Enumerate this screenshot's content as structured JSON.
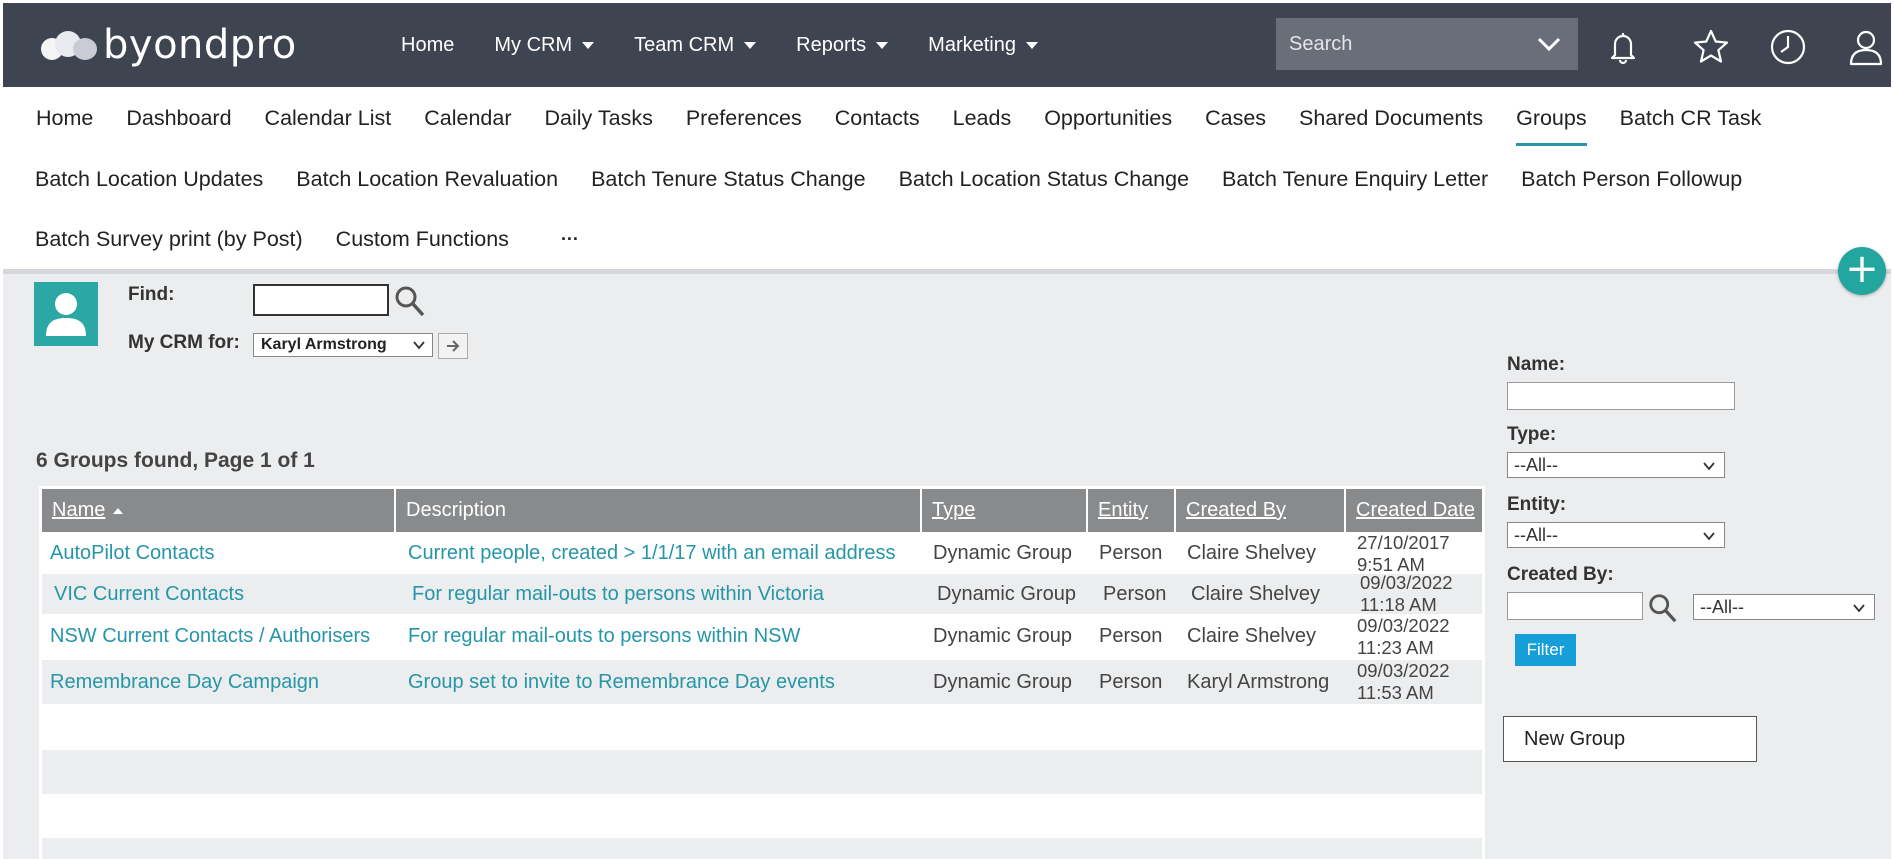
{
  "brand": {
    "name": "byondpro"
  },
  "main_nav": [
    {
      "label": "Home",
      "has_dropdown": false
    },
    {
      "label": "My CRM",
      "has_dropdown": true
    },
    {
      "label": "Team CRM",
      "has_dropdown": true
    },
    {
      "label": "Reports",
      "has_dropdown": true
    },
    {
      "label": "Marketing",
      "has_dropdown": true
    }
  ],
  "search": {
    "placeholder": "Search"
  },
  "top_icons": [
    "bell-icon",
    "star-icon",
    "clock-icon",
    "user-icon"
  ],
  "sub_nav": {
    "row1": [
      "Home",
      "Dashboard",
      "Calendar List",
      "Calendar",
      "Daily Tasks",
      "Preferences",
      "Contacts",
      "Leads",
      "Opportunities",
      "Cases",
      "Shared Documents",
      "Groups",
      "Batch CR Task"
    ],
    "row2": [
      "Batch Location Updates",
      "Batch Location Revaluation",
      "Batch Tenure Status Change",
      "Batch Location Status Change",
      "Batch Tenure Enquiry Letter",
      "Batch Person Followup"
    ],
    "row3": [
      "Batch Survey print (by Post)",
      "Custom Functions",
      "···"
    ],
    "active": "Groups"
  },
  "find": {
    "label": "Find:",
    "value": ""
  },
  "crm_for": {
    "label": "My CRM for:",
    "selected": "Karyl Armstrong"
  },
  "results_title": "6 Groups found, Page 1 of 1",
  "table": {
    "columns": [
      "Name",
      "Description",
      "Type",
      "Entity",
      "Created By",
      "Created Date"
    ],
    "rows": [
      {
        "name": "AutoPilot Contacts",
        "description": "Current people, created > 1/1/17 with an email address",
        "type": "Dynamic Group",
        "entity": "Person",
        "created_by": "Claire Shelvey",
        "date": "27/10/2017",
        "time": "9:51 AM"
      },
      {
        "name": "VIC Current Contacts",
        "description": "For regular mail-outs to persons within Victoria",
        "type": "Dynamic Group",
        "entity": "Person",
        "created_by": "Claire Shelvey",
        "date": "09/03/2022",
        "time": "11:18 AM"
      },
      {
        "name": "NSW Current Contacts / Authorisers",
        "description": "For regular mail-outs to persons within NSW",
        "type": "Dynamic Group",
        "entity": "Person",
        "created_by": "Claire Shelvey",
        "date": "09/03/2022",
        "time": "11:23 AM"
      },
      {
        "name": "Remembrance Day Campaign",
        "description": "Group set to invite to Remembrance Day events",
        "type": "Dynamic Group",
        "entity": "Person",
        "created_by": "Karyl Armstrong",
        "date": "09/03/2022",
        "time": "11:53 AM"
      }
    ]
  },
  "filters": {
    "name_label": "Name:",
    "name_value": "",
    "type_label": "Type:",
    "type_selected": "--All--",
    "entity_label": "Entity:",
    "entity_selected": "--All--",
    "created_by_label": "Created By:",
    "created_by_value": "",
    "created_by_selected": "--All--",
    "filter_button": "Filter"
  },
  "new_group_button": "New Group",
  "colors": {
    "topbar": "#3f4451",
    "accent": "#2596a8",
    "fab": "#23a6a0",
    "filter_button": "#159ed8",
    "table_header": "#888a8c"
  }
}
